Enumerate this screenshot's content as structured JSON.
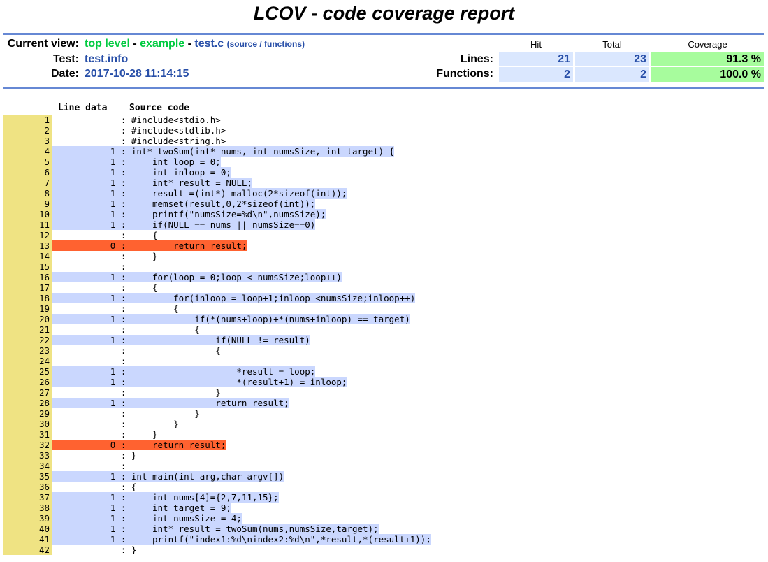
{
  "title": "LCOV - code coverage report",
  "header": {
    "current_view_label": "Current view:",
    "nav_top": "top level",
    "sep1": " - ",
    "nav_example": "example",
    "sep2": " - ",
    "current_file": "test.c",
    "source_prefix": "(source / ",
    "functions_link": "functions",
    "source_suffix": ")",
    "test_label": "Test:",
    "test_value": "test.info",
    "date_label": "Date:",
    "date_value": "2017-10-28 11:14:15"
  },
  "summary": {
    "col_hit": "Hit",
    "col_total": "Total",
    "col_coverage": "Coverage",
    "lines_label": "Lines:",
    "lines_hit": "21",
    "lines_total": "23",
    "lines_cov": "91.3 %",
    "functions_label": "Functions:",
    "functions_hit": "2",
    "functions_total": "2",
    "functions_cov": "100.0 %"
  },
  "source_header": {
    "line_data": "Line data",
    "source_code": "Source code"
  },
  "colors": {
    "line_number_bg": "#efe383",
    "hit_bg": "#cad7fe",
    "miss_bg": "#ff6230",
    "coverage_hi_bg": "#a7fc9d",
    "rule": "#6688d4"
  },
  "lines": [
    {
      "n": "1",
      "count": "",
      "status": "none",
      "code": "#include<stdio.h>"
    },
    {
      "n": "2",
      "count": "",
      "status": "none",
      "code": "#include<stdlib.h>"
    },
    {
      "n": "3",
      "count": "",
      "status": "none",
      "code": "#include<string.h>"
    },
    {
      "n": "4",
      "count": "1",
      "status": "hit",
      "code": "int* twoSum(int* nums, int numsSize, int target) {"
    },
    {
      "n": "5",
      "count": "1",
      "status": "hit",
      "code": "    int loop = 0;"
    },
    {
      "n": "6",
      "count": "1",
      "status": "hit",
      "code": "    int inloop = 0;"
    },
    {
      "n": "7",
      "count": "1",
      "status": "hit",
      "code": "    int* result = NULL;"
    },
    {
      "n": "8",
      "count": "1",
      "status": "hit",
      "code": "    result =(int*) malloc(2*sizeof(int));"
    },
    {
      "n": "9",
      "count": "1",
      "status": "hit",
      "code": "    memset(result,0,2*sizeof(int));"
    },
    {
      "n": "10",
      "count": "1",
      "status": "hit",
      "code": "    printf(\"numsSize=%d\\n\",numsSize);"
    },
    {
      "n": "11",
      "count": "1",
      "status": "hit",
      "code": "    if(NULL == nums || numsSize==0)"
    },
    {
      "n": "12",
      "count": "",
      "status": "none",
      "code": "    {"
    },
    {
      "n": "13",
      "count": "0",
      "status": "miss",
      "code": "        return result;"
    },
    {
      "n": "14",
      "count": "",
      "status": "none",
      "code": "    }"
    },
    {
      "n": "15",
      "count": "",
      "status": "none",
      "code": ""
    },
    {
      "n": "16",
      "count": "1",
      "status": "hit",
      "code": "    for(loop = 0;loop < numsSize;loop++)"
    },
    {
      "n": "17",
      "count": "",
      "status": "none",
      "code": "    {"
    },
    {
      "n": "18",
      "count": "1",
      "status": "hit",
      "code": "        for(inloop = loop+1;inloop <numsSize;inloop++)"
    },
    {
      "n": "19",
      "count": "",
      "status": "none",
      "code": "        {"
    },
    {
      "n": "20",
      "count": "1",
      "status": "hit",
      "code": "            if(*(nums+loop)+*(nums+inloop) == target)"
    },
    {
      "n": "21",
      "count": "",
      "status": "none",
      "code": "            {"
    },
    {
      "n": "22",
      "count": "1",
      "status": "hit",
      "code": "                if(NULL != result)"
    },
    {
      "n": "23",
      "count": "",
      "status": "none",
      "code": "                {"
    },
    {
      "n": "24",
      "count": "",
      "status": "none",
      "code": ""
    },
    {
      "n": "25",
      "count": "1",
      "status": "hit",
      "code": "                    *result = loop;"
    },
    {
      "n": "26",
      "count": "1",
      "status": "hit",
      "code": "                    *(result+1) = inloop;"
    },
    {
      "n": "27",
      "count": "",
      "status": "none",
      "code": "                }"
    },
    {
      "n": "28",
      "count": "1",
      "status": "hit",
      "code": "                return result;"
    },
    {
      "n": "29",
      "count": "",
      "status": "none",
      "code": "            }"
    },
    {
      "n": "30",
      "count": "",
      "status": "none",
      "code": "        }"
    },
    {
      "n": "31",
      "count": "",
      "status": "none",
      "code": "    }"
    },
    {
      "n": "32",
      "count": "0",
      "status": "miss",
      "code": "    return result;"
    },
    {
      "n": "33",
      "count": "",
      "status": "none",
      "code": "}"
    },
    {
      "n": "34",
      "count": "",
      "status": "none",
      "code": ""
    },
    {
      "n": "35",
      "count": "1",
      "status": "hit",
      "code": "int main(int arg,char argv[])"
    },
    {
      "n": "36",
      "count": "",
      "status": "none",
      "code": "{"
    },
    {
      "n": "37",
      "count": "1",
      "status": "hit",
      "code": "    int nums[4]={2,7,11,15};"
    },
    {
      "n": "38",
      "count": "1",
      "status": "hit",
      "code": "    int target = 9;"
    },
    {
      "n": "39",
      "count": "1",
      "status": "hit",
      "code": "    int numsSize = 4;"
    },
    {
      "n": "40",
      "count": "1",
      "status": "hit",
      "code": "    int* result = twoSum(nums,numsSize,target);"
    },
    {
      "n": "41",
      "count": "1",
      "status": "hit",
      "code": "    printf(\"index1:%d\\nindex2:%d\\n\",*result,*(result+1));"
    },
    {
      "n": "42",
      "count": "",
      "status": "none",
      "code": "}"
    }
  ]
}
